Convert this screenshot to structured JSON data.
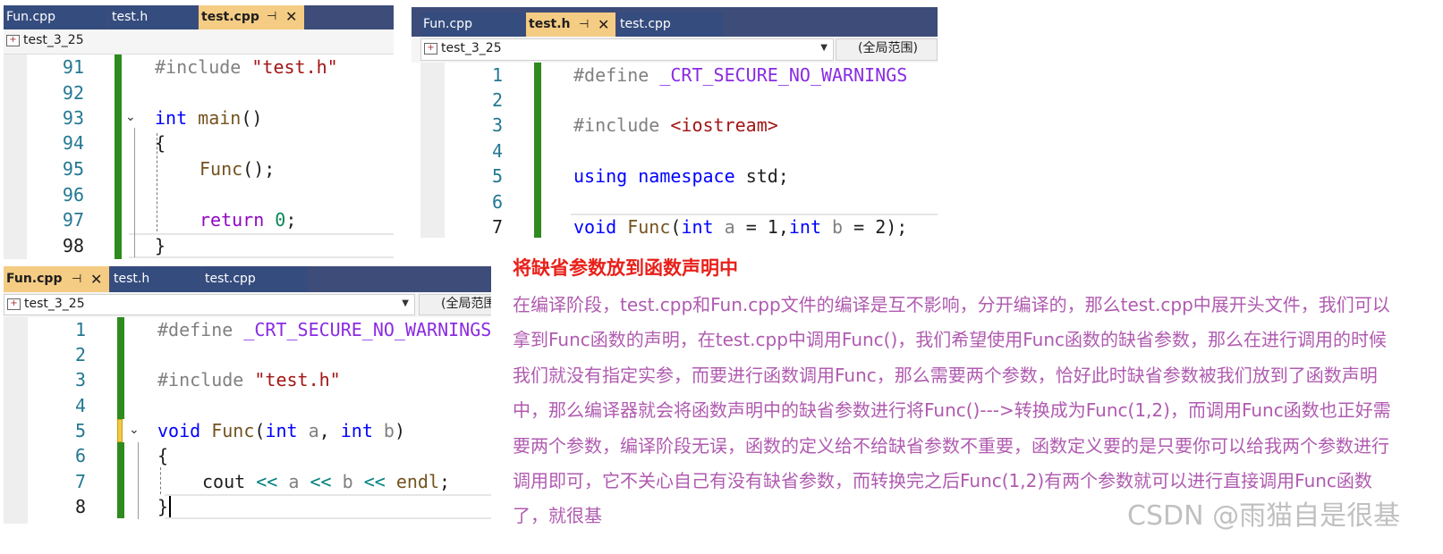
{
  "panel_a": {
    "tabs": [
      {
        "label": "Fun.cpp",
        "active": false
      },
      {
        "label": "test.h",
        "active": false
      },
      {
        "label": "test.cpp",
        "active": true
      }
    ],
    "nav_project": "test_3_25",
    "line_numbers": [
      "91",
      "92",
      "93",
      "94",
      "95",
      "96",
      "97",
      "98"
    ],
    "code": {
      "l91_directive": "#include",
      "l91_header": "\"test.h\"",
      "l93_type": "int",
      "l93_name": "main",
      "l93_parens": "()",
      "l94_brace": "{",
      "l95_call": "Func",
      "l95_rest": "();",
      "l97_return": "return",
      "l97_value": "0",
      "l97_semi": ";",
      "l98_brace": "}"
    }
  },
  "panel_b": {
    "tabs": [
      {
        "label": "Fun.cpp",
        "active": false
      },
      {
        "label": "test.h",
        "active": true
      },
      {
        "label": "test.cpp",
        "active": false
      }
    ],
    "nav_project": "test_3_25",
    "nav_scope": "(全局范围)",
    "line_numbers": [
      "1",
      "2",
      "3",
      "4",
      "5",
      "6",
      "7"
    ],
    "code": {
      "l1_directive": "#define",
      "l1_macro": "_CRT_SECURE_NO_WARNINGS",
      "l3_directive": "#include",
      "l3_header": "<iostream>",
      "l5_using": "using",
      "l5_namespace": "namespace",
      "l5_rest": "std;",
      "l7_void": "void",
      "l7_name": "Func",
      "l7_open": "(",
      "l7_int1": "int",
      "l7_a": "a",
      "l7_eq1": " = ",
      "l7_one": "1",
      "l7_comma": ",",
      "l7_int2": "int",
      "l7_b": "b",
      "l7_eq2": " = ",
      "l7_two": "2",
      "l7_close": ");"
    }
  },
  "panel_c": {
    "tabs": [
      {
        "label": "Fun.cpp",
        "active": true
      },
      {
        "label": "test.h",
        "active": false
      },
      {
        "label": "test.cpp",
        "active": false
      }
    ],
    "nav_project": "test_3_25",
    "nav_scope": "(全局范围)",
    "line_numbers": [
      "1",
      "2",
      "3",
      "4",
      "5",
      "6",
      "7",
      "8"
    ],
    "code": {
      "l1_directive": "#define",
      "l1_macro": "_CRT_SECURE_NO_WARNINGS",
      "l3_directive": "#include",
      "l3_header": "\"test.h\"",
      "l5_void": "void",
      "l5_name": "Func",
      "l5_open": "(",
      "l5_int1": "int",
      "l5_a": "a",
      "l5_comma": ", ",
      "l5_int2": "int",
      "l5_b": "b",
      "l5_close": ")",
      "l6_brace": "{",
      "l7_cout": "cout",
      "l7_op1": "<<",
      "l7_a": "a",
      "l7_op2": "<<",
      "l7_b": "b",
      "l7_op3": "<<",
      "l7_endl": "endl",
      "l7_semi": ";",
      "l8_brace": "}"
    }
  },
  "explanation": {
    "heading": "将缺省参数放到函数声明中",
    "body": "在编译阶段，test.cpp和Fun.cpp文件的编译是互不影响，分开编译的，那么test.cpp中展开头文件，我们可以拿到Func函数的声明，在test.cpp中调用Func()，我们希望使用Func函数的缺省参数，那么在进行调用的时候我们就没有指定实参，而要进行函数调用Func，那么需要两个参数，恰好此时缺省参数被我们放到了函数声明中，那么编译器就会将函数声明中的缺省参数进行将Func()--->转换成为Func(1,2)，而调用Func函数也正好需要两个参数，编译阶段无误，函数的定义给不给缺省参数不重要，函数定义要的是只要你可以给我两个参数进行调用即可，它不关心自己有没有缺省参数，而转换完之后Func(1,2)有两个参数就可以进行直接调用Func函数了，就很基"
  },
  "watermark": "CSDN @雨猫自是很基"
}
